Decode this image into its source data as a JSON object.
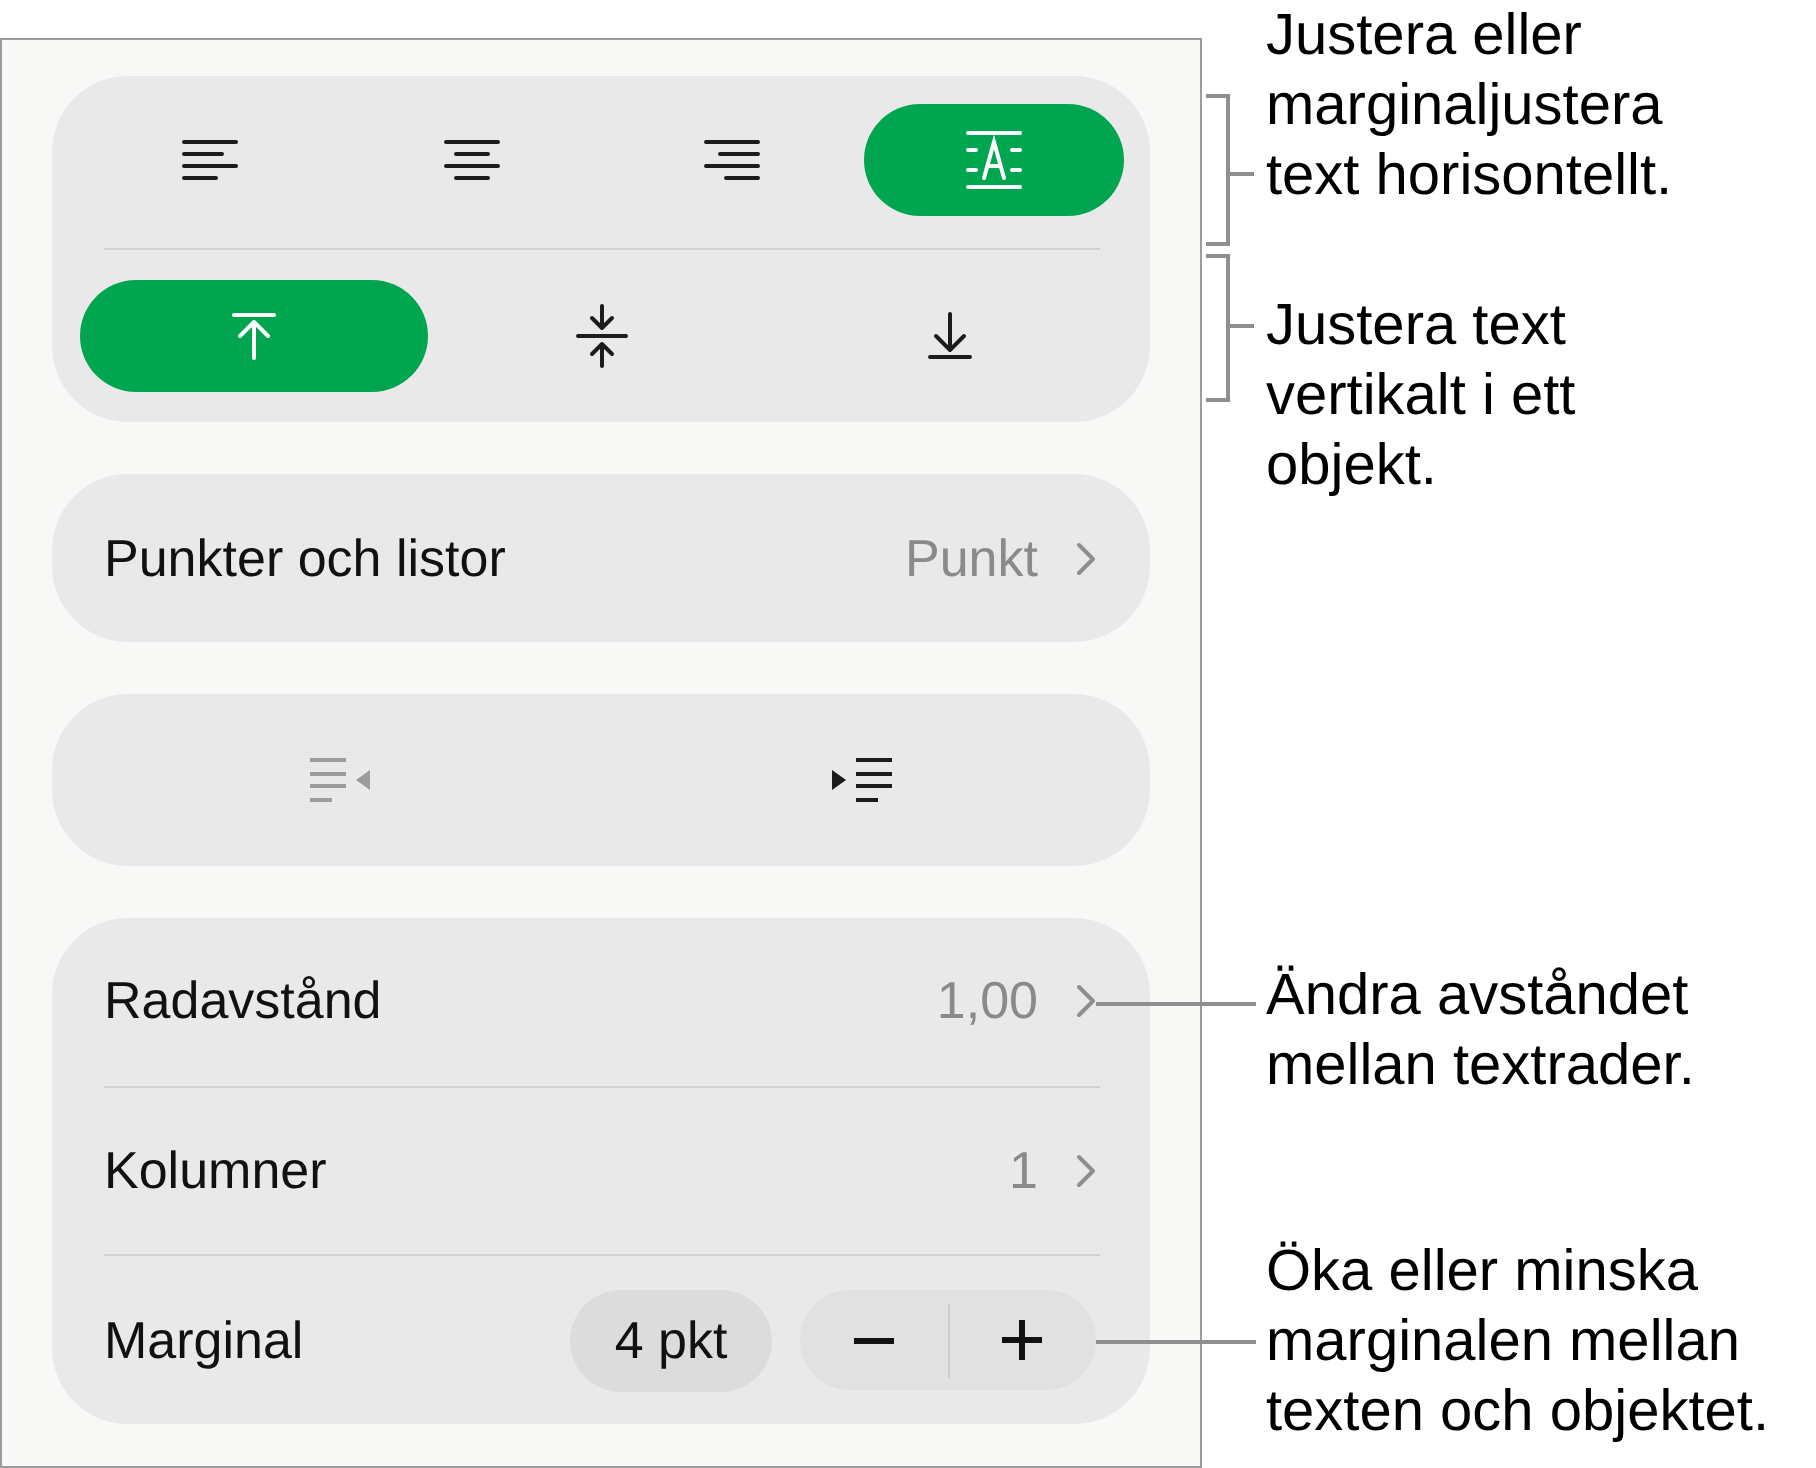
{
  "horizontal_alignment": [
    {
      "kind": "left",
      "selected": false
    },
    {
      "kind": "center",
      "selected": false
    },
    {
      "kind": "right",
      "selected": false
    },
    {
      "kind": "justify",
      "selected": true
    }
  ],
  "vertical_alignment": [
    {
      "kind": "top",
      "selected": true
    },
    {
      "kind": "middle",
      "selected": false
    },
    {
      "kind": "bottom",
      "selected": false
    }
  ],
  "bullets_and_lists": {
    "label": "Punkter och listor",
    "value": "Punkt"
  },
  "indent": [
    {
      "kind": "decrease",
      "disabled": true
    },
    {
      "kind": "increase",
      "disabled": false
    }
  ],
  "rows": [
    {
      "kind": "disclosure",
      "label": "Radavstånd",
      "value": "1,00"
    },
    {
      "kind": "disclosure",
      "label": "Kolumner",
      "value": "1"
    },
    {
      "kind": "stepper",
      "label": "Marginal",
      "value": "4 pkt"
    }
  ],
  "callouts": [
    {
      "kind": "bracket",
      "text": "Justera eller\nmarginaljustera\ntext horisontellt."
    },
    {
      "kind": "bracket",
      "text": "Justera text\nvertikalt i ett\nobjekt."
    },
    {
      "kind": "leader",
      "text": "Ändra avståndet\nmellan textrader."
    },
    {
      "kind": "leader",
      "text": "Öka eller minska\nmarginalen mellan\ntexten och objektet."
    }
  ]
}
